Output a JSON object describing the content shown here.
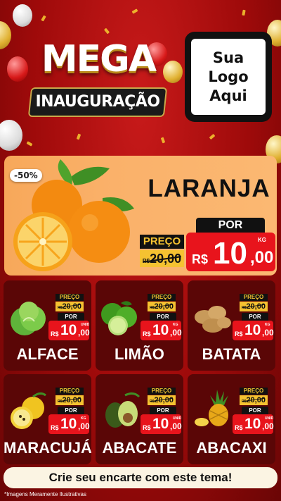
{
  "header": {
    "title_line1": "MEGA",
    "title_line2": "INAUGURAÇÃO",
    "logo_placeholder": "Sua Logo Aqui"
  },
  "featured": {
    "discount_badge": "-50%",
    "product": "LARANJA",
    "old_price_label": "PREÇO",
    "old_price_currency": "R$",
    "old_price": "20,00",
    "new_price_label": "POR",
    "currency": "R$",
    "price_int": "10",
    "price_cents": ",00",
    "unit": "KG"
  },
  "products": [
    {
      "name": "ALFACE",
      "unit": "UNID",
      "icon": "lettuce-icon"
    },
    {
      "name": "LIMÃO",
      "unit": "KG",
      "icon": "lime-icon"
    },
    {
      "name": "BATATA",
      "unit": "KG",
      "icon": "potato-icon"
    },
    {
      "name": "MARACUJÁ",
      "unit": "KG",
      "icon": "passion-fruit-icon"
    },
    {
      "name": "ABACATE",
      "unit": "UNID",
      "icon": "avocado-icon"
    },
    {
      "name": "ABACAXI",
      "unit": "UNID",
      "icon": "pineapple-icon"
    }
  ],
  "card_labels": {
    "old_price_label": "PREÇO",
    "old_price_currency": "R$",
    "old_price": "20,00",
    "new_price_label": "POR",
    "currency": "R$",
    "price_int": "10",
    "price_cents": ",00"
  },
  "cta": "Crie seu encarte com este tema!",
  "disclaimer": "*Imagens Meramente Ilustrativas",
  "colors": {
    "background": "#b01212",
    "price_red": "#e8141c",
    "tag_yellow": "#f5c231",
    "hero_orange": "#fab16a"
  }
}
